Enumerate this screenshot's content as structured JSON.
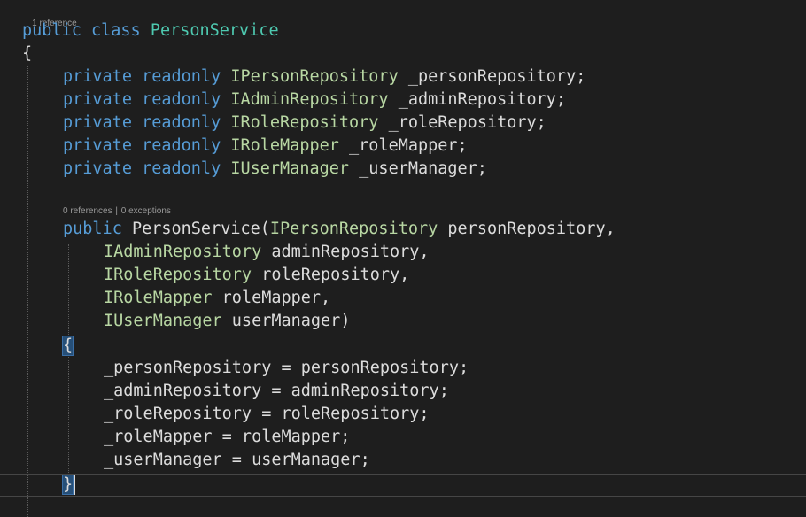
{
  "colors": {
    "background": "#1e1e1e",
    "keyword": "#569cd6",
    "class_type": "#4ec9b0",
    "interface_type": "#b8d7a3",
    "identifier": "#dcdcdc",
    "codelens": "#999999",
    "brace_highlight": "#264f78"
  },
  "codelens": {
    "class_refs": "1 reference",
    "ctor_refs": "0 references",
    "ctor_separator": "|",
    "ctor_exceptions": "0 exceptions"
  },
  "code": {
    "class_decl": {
      "kw1": "public",
      "kw2": "class",
      "name": "PersonService"
    },
    "open_brace": "{",
    "fields": [
      {
        "kw1": "private",
        "kw2": "readonly",
        "type": "IPersonRepository",
        "name": "_personRepository;"
      },
      {
        "kw1": "private",
        "kw2": "readonly",
        "type": "IAdminRepository",
        "name": "_adminRepository;"
      },
      {
        "kw1": "private",
        "kw2": "readonly",
        "type": "IRoleRepository",
        "name": "_roleRepository;"
      },
      {
        "kw1": "private",
        "kw2": "readonly",
        "type": "IRoleMapper",
        "name": "_roleMapper;"
      },
      {
        "kw1": "private",
        "kw2": "readonly",
        "type": "IUserManager",
        "name": "_userManager;"
      }
    ],
    "ctor": {
      "kw": "public",
      "name": "PersonService(",
      "first_param_type": "IPersonRepository",
      "first_param_name": "personRepository,"
    },
    "params": [
      {
        "type": "IAdminRepository",
        "name": "adminRepository,"
      },
      {
        "type": "IRoleRepository",
        "name": "roleRepository,"
      },
      {
        "type": "IRoleMapper",
        "name": "roleMapper,"
      },
      {
        "type": "IUserManager",
        "name": "userManager)"
      }
    ],
    "ctor_open_brace": "{",
    "assignments": [
      "_personRepository = personRepository;",
      "_adminRepository = adminRepository;",
      "_roleRepository = roleRepository;",
      "_roleMapper = roleMapper;",
      "_userManager = userManager;"
    ],
    "ctor_close_brace": "}"
  }
}
